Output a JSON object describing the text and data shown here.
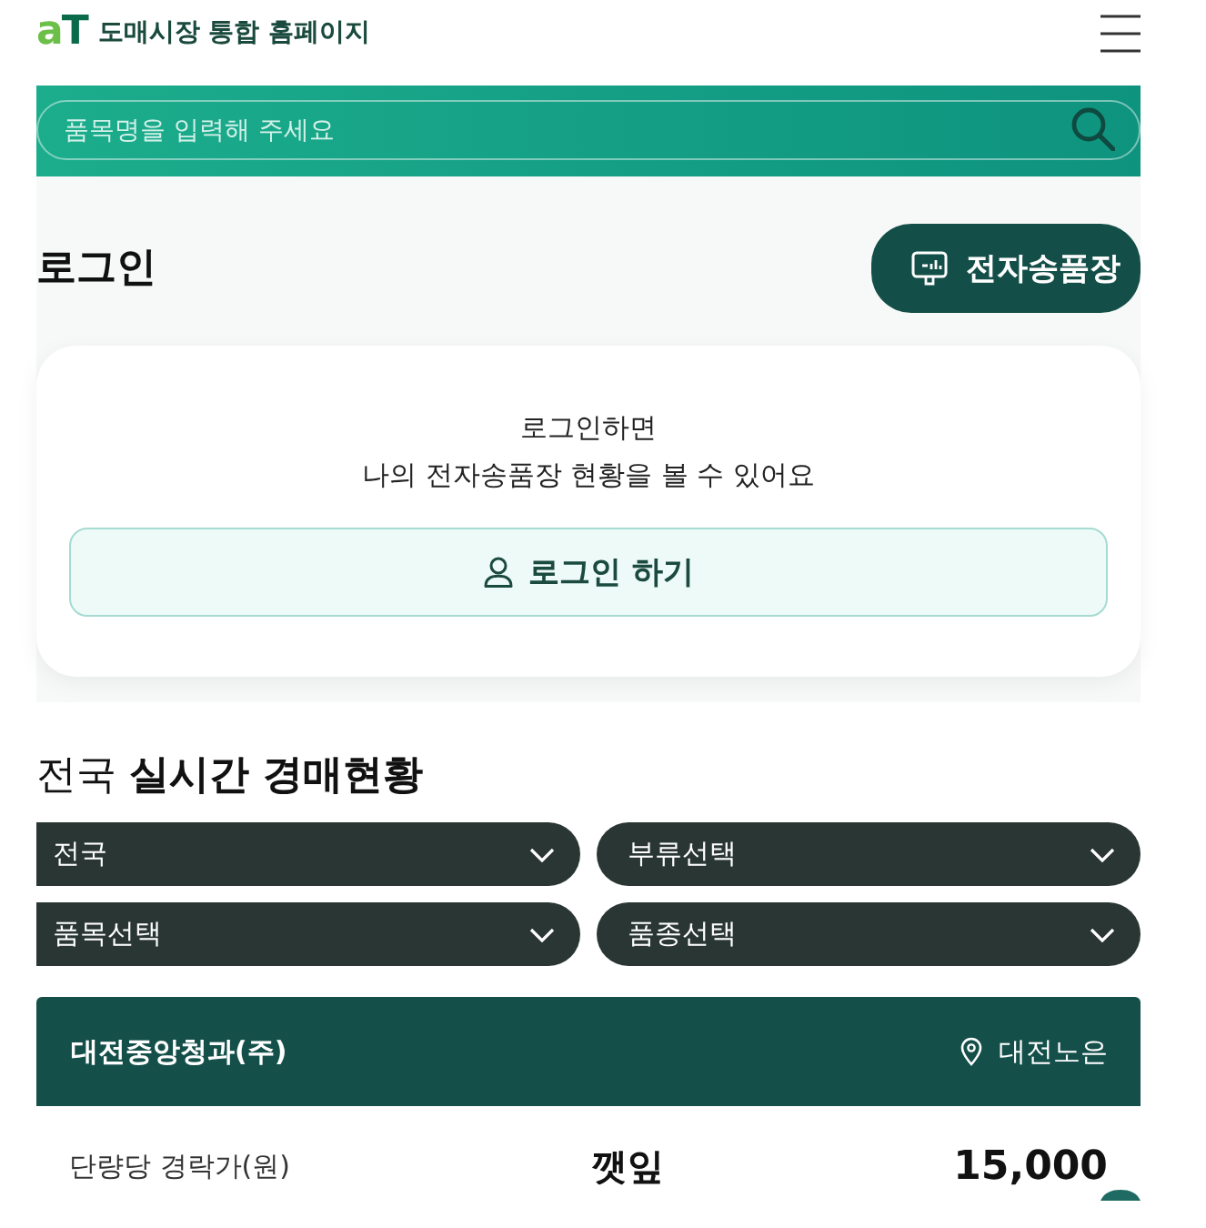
{
  "header": {
    "logo": "aT",
    "site_title": "도매시장 통합 홈페이지"
  },
  "search": {
    "placeholder": "품목명을 입력해 주세요"
  },
  "login_section": {
    "title": "로그인",
    "invoice_button": "전자송품장",
    "message_lines": [
      "로그인하면",
      "나의 전자송품장 현황을 볼 수 있어요"
    ],
    "login_button": "로그인 하기"
  },
  "auction_section": {
    "title": "전국 **실시간 경매현황**",
    "filters": [
      {
        "label": "전국"
      },
      {
        "label": "부류선택"
      },
      {
        "label": "품목선택"
      },
      {
        "label": "품종선택"
      }
    ],
    "market_card": {
      "market": "대전중앙청과(주)",
      "location": "대전노은",
      "price_label": "단량당 경락가(원)",
      "item": "깻잎",
      "price": "15,000"
    }
  }
}
